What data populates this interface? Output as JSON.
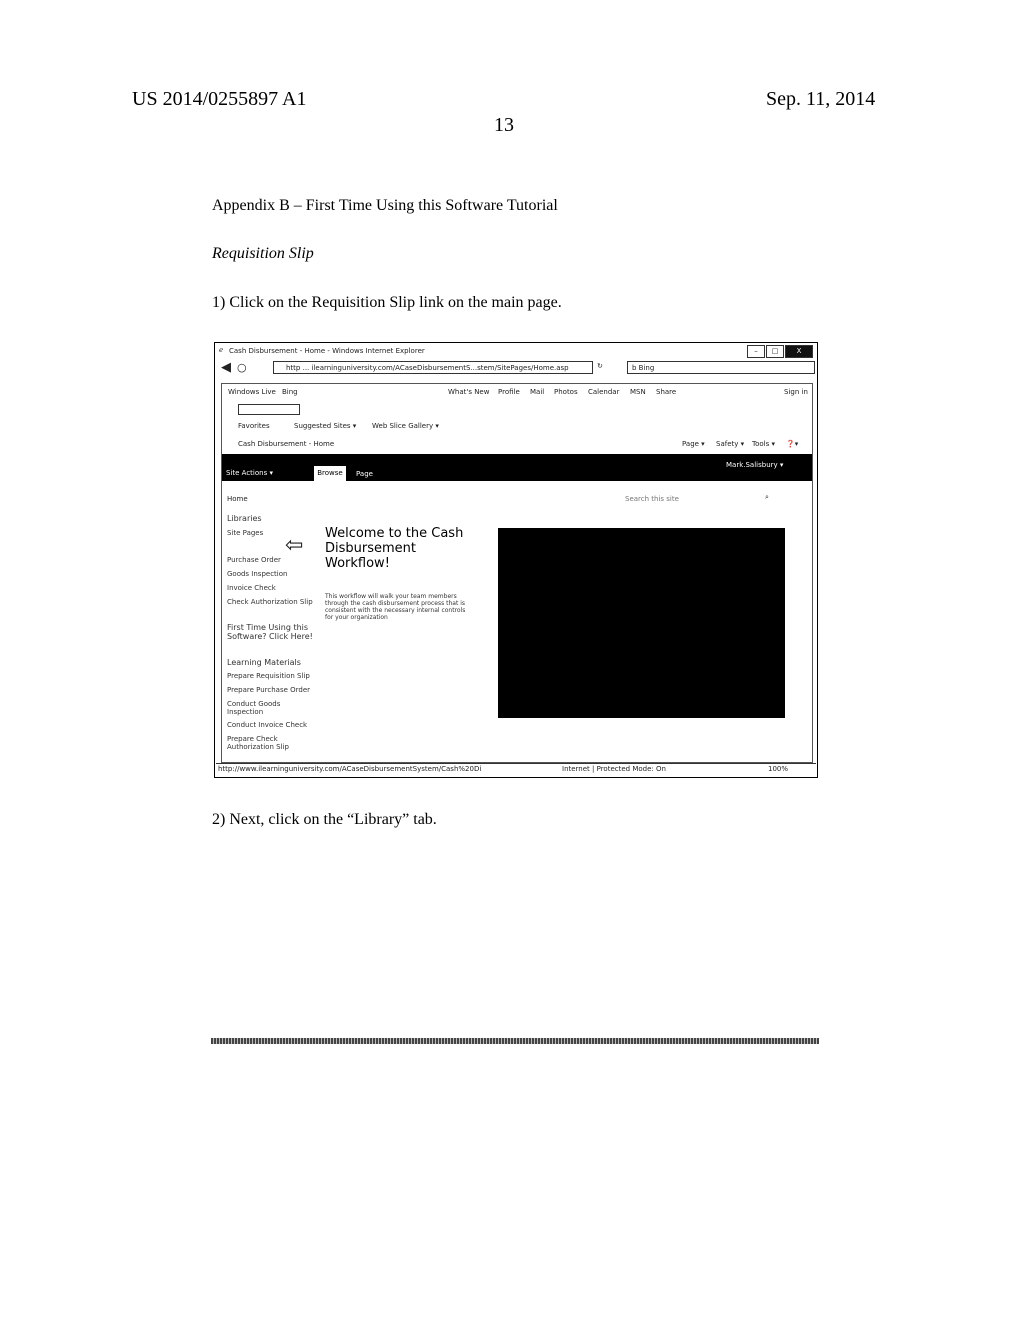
{
  "header": {
    "publication_number": "US 2014/0255897 A1",
    "date": "Sep. 11, 2014",
    "page_number": "13"
  },
  "body": {
    "appendix_title": "Appendix B – First Time Using this Software Tutorial",
    "section_title": "Requisition Slip",
    "step1": "1)  Click on the Requisition Slip link on the main page.",
    "step2": "2) Next, click on the “Library” tab."
  },
  "browser": {
    "window_title": "Cash Disbursement - Home - Windows Internet Explorer",
    "window_buttons": [
      "–",
      "□",
      "X"
    ],
    "address": "http ... ilearninguniversity.com/ACaseDisbursementS...stem/SitePages/Home.asp",
    "search_placeholder": "Bing",
    "live_bar": {
      "windows_live": "Windows Live",
      "bing": "Bing",
      "links": [
        "What's New",
        "Profile",
        "Mail",
        "Photos",
        "Calendar",
        "MSN",
        "Share"
      ],
      "sign_in": "Sign in"
    },
    "favorites_bar": {
      "favorites": "Favorites",
      "suggested_sites": "Suggested Sites ▾",
      "web_slice_gallery": "Web Slice Gallery ▾"
    },
    "tab_title": "Cash Disbursement - Home",
    "command_bar": [
      "Page ▾",
      "Safety ▾",
      "Tools ▾",
      "❓▾"
    ],
    "ribbon": {
      "site_actions": "Site Actions ▾",
      "tabs": [
        "Browse",
        "Page"
      ],
      "user": "Mark.Salisbury ▾"
    },
    "breadcrumb": "Home",
    "site_search_placeholder": "Search this site",
    "nav": [
      "Libraries",
      "Site Pages",
      "Purchase Order",
      "Goods Inspection",
      "Invoice Check",
      "Check Authorization Slip",
      "First Time Using this Software? Click Here!",
      "Learning Materials",
      "Prepare Requisition Slip",
      "Prepare Purchase Order",
      "Conduct Goods Inspection",
      "Conduct Invoice Check",
      "Prepare Check Authorization Slip"
    ],
    "welcome_heading": "Welcome to the Cash Disbursement Workflow!",
    "welcome_text": "This workflow will walk your team members through the cash disbursement process that is consistent with the necessary internal controls for your organization",
    "status_url": "http://www.ilearninguniversity.com/ACaseDisbursementSystem/Cash%20Di",
    "status_zone": "Internet | Protected Mode: On",
    "zoom_level": "100%"
  }
}
